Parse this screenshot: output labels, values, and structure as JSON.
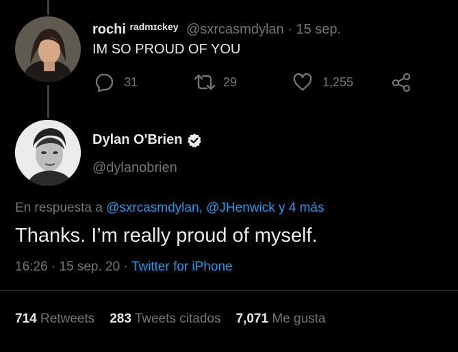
{
  "reply_tweet": {
    "display_name": "rochi",
    "name_suffix": "radmɪckey",
    "handle": "@sxrcasmdylan",
    "separator": "·",
    "date": "15 sep.",
    "text": "IM SO PROUD OF YOU",
    "actions": {
      "reply_count": "31",
      "retweet_count": "29",
      "like_count": "1,255"
    }
  },
  "main_tweet": {
    "display_name": "Dylan O'Brien",
    "handle": "@dylanobrien",
    "reply_prefix": "En respuesta a",
    "reply_to": "@sxrcasmdylan, @JHenwick y 4 más",
    "text": "Thanks. I’m really proud of myself.",
    "time": "16:26",
    "sep1": "·",
    "date": "15 sep. 20",
    "sep2": "·",
    "source": "Twitter for iPhone"
  },
  "stats": {
    "retweets_count": "714",
    "retweets_label": "Retweets",
    "quotes_count": "283",
    "quotes_label": "Tweets citados",
    "likes_count": "7,071",
    "likes_label": "Me gusta"
  },
  "colors": {
    "background": "#000000",
    "text": "#e7e9ea",
    "secondary": "#71767b",
    "link": "#1d9bf0",
    "divider": "#2f3336"
  },
  "icons": [
    "reply-icon",
    "retweet-icon",
    "like-icon",
    "share-icon",
    "verified-badge-icon"
  ]
}
